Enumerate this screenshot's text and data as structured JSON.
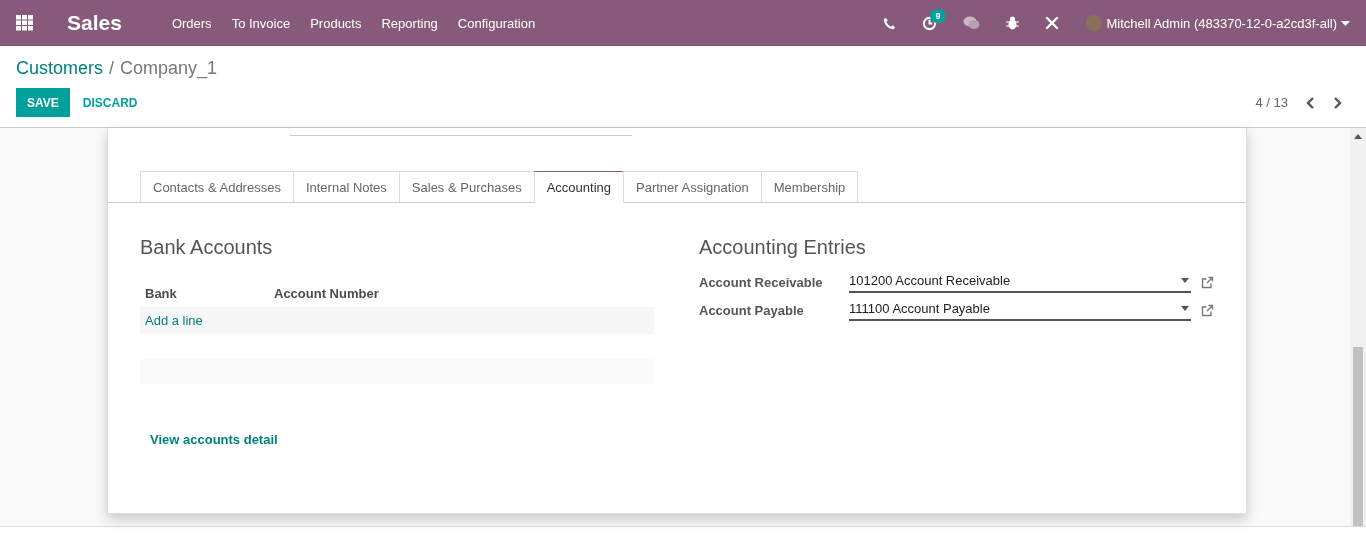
{
  "navbar": {
    "app_name": "Sales",
    "menu": [
      "Orders",
      "To Invoice",
      "Products",
      "Reporting",
      "Configuration"
    ],
    "activity_count": "9",
    "user": "Mitchell Admin (483370-12-0-a2cd3f-all)"
  },
  "breadcrumb": {
    "parent": "Customers",
    "separator": "/",
    "current": "Company_1"
  },
  "buttons": {
    "save": "SAVE",
    "discard": "DISCARD"
  },
  "pager": "4 / 13",
  "tabs": [
    {
      "label": "Contacts & Addresses",
      "selected": false
    },
    {
      "label": "Internal Notes",
      "selected": false
    },
    {
      "label": "Sales & Purchases",
      "selected": false
    },
    {
      "label": "Accounting",
      "selected": true
    },
    {
      "label": "Partner Assignation",
      "selected": false
    },
    {
      "label": "Membership",
      "selected": false
    }
  ],
  "bank_accounts": {
    "title": "Bank Accounts",
    "columns": [
      "Bank",
      "Account Number"
    ],
    "add_line": "Add a line",
    "detail_link": "View accounts detail"
  },
  "accounting_entries": {
    "title": "Accounting Entries",
    "fields": [
      {
        "label": "Account Receivable",
        "value": "101200 Account Receivable"
      },
      {
        "label": "Account Payable",
        "value": "111100 Account Payable"
      }
    ]
  }
}
